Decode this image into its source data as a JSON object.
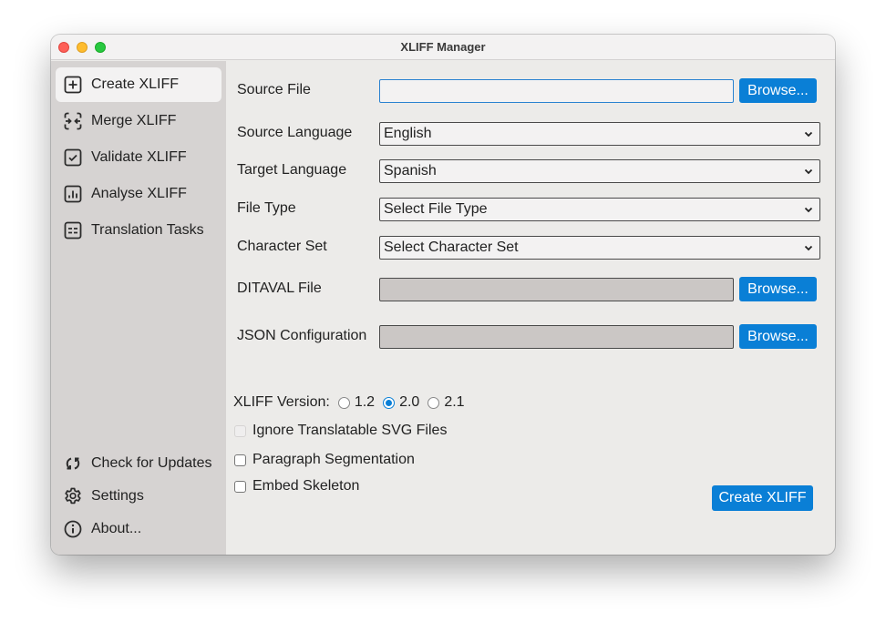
{
  "window": {
    "title": "XLIFF Manager"
  },
  "sidebar": {
    "items": [
      {
        "label": "Create XLIFF",
        "icon": "plus-square-icon",
        "active": true
      },
      {
        "label": "Merge XLIFF",
        "icon": "merge-arrows-icon",
        "active": false
      },
      {
        "label": "Validate XLIFF",
        "icon": "check-square-icon",
        "active": false
      },
      {
        "label": "Analyse XLIFF",
        "icon": "bar-chart-square-icon",
        "active": false
      },
      {
        "label": "Translation Tasks",
        "icon": "tasks-list-icon",
        "active": false
      }
    ],
    "bottom_items": [
      {
        "label": "Check for Updates",
        "icon": "refresh-icon"
      },
      {
        "label": "Settings",
        "icon": "gear-icon"
      },
      {
        "label": "About...",
        "icon": "info-icon"
      }
    ]
  },
  "form": {
    "source_file": {
      "label": "Source File",
      "value": "",
      "browse_label": "Browse..."
    },
    "source_language": {
      "label": "Source Language",
      "selected": "English"
    },
    "target_language": {
      "label": "Target Language",
      "selected": "Spanish"
    },
    "file_type": {
      "label": "File Type",
      "selected": "Select File Type"
    },
    "character_set": {
      "label": "Character Set",
      "selected": "Select Character Set"
    },
    "ditaval_file": {
      "label": "DITAVAL File",
      "value": "",
      "browse_label": "Browse..."
    },
    "json_configuration": {
      "label": "JSON Configuration",
      "value": "",
      "browse_label": "Browse..."
    },
    "xliff_version": {
      "label": "XLIFF Version:",
      "options": [
        "1.2",
        "2.0",
        "2.1"
      ],
      "selected": "2.0"
    },
    "checkboxes": [
      {
        "label": "Ignore Translatable SVG Files",
        "checked": false,
        "disabled": true
      },
      {
        "label": "Paragraph Segmentation",
        "checked": false,
        "disabled": false
      },
      {
        "label": "Embed Skeleton",
        "checked": false,
        "disabled": false
      }
    ],
    "submit_label": "Create XLIFF"
  },
  "colors": {
    "accent": "#0a7fd6",
    "sidebar_bg": "#d6d3d2",
    "main_bg": "#ecebe9"
  }
}
